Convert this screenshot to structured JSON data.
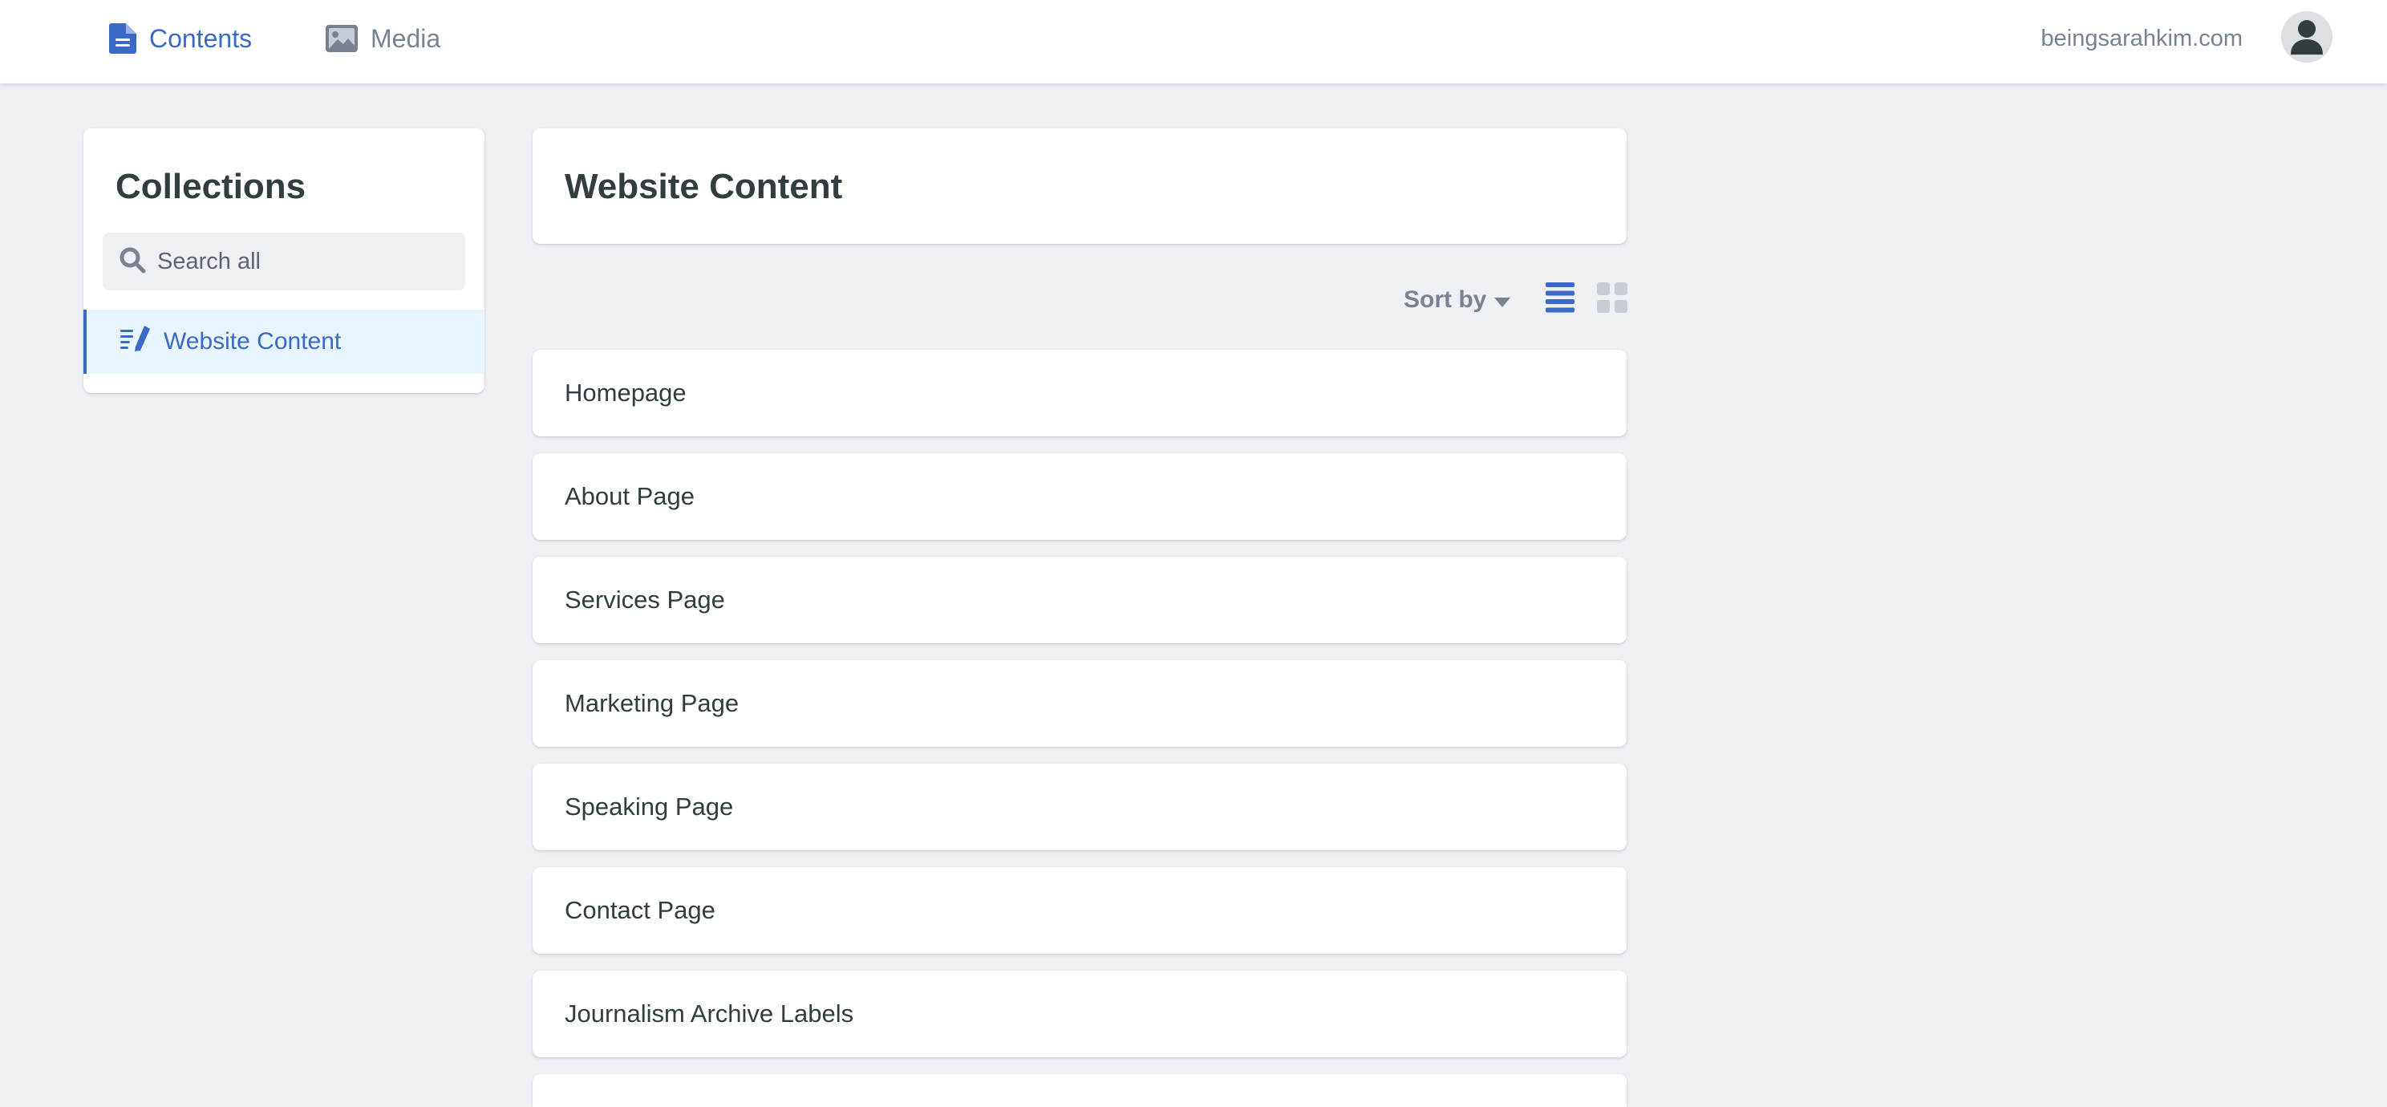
{
  "topbar": {
    "tabs": [
      {
        "label": "Contents",
        "icon": "document-icon",
        "active": true
      },
      {
        "label": "Media",
        "icon": "image-icon",
        "active": false
      }
    ],
    "site_name": "beingsarahkim.com",
    "avatar_icon": "user-icon"
  },
  "sidebar": {
    "title": "Collections",
    "search": {
      "placeholder": "Search all",
      "value": ""
    },
    "collections": [
      {
        "label": "Website Content",
        "icon": "edit-list-icon",
        "active": true
      }
    ]
  },
  "main": {
    "title": "Website Content",
    "sort_label": "Sort by",
    "entries": [
      "Homepage",
      "About Page",
      "Services Page",
      "Marketing Page",
      "Speaking Page",
      "Contact Page",
      "Journalism Archive Labels",
      ""
    ]
  },
  "colors": {
    "accent": "#3a69c7",
    "muted": "#798291",
    "background": "#eff0f4",
    "active_item_bg": "#e8f5fe",
    "text": "#313d3e"
  }
}
